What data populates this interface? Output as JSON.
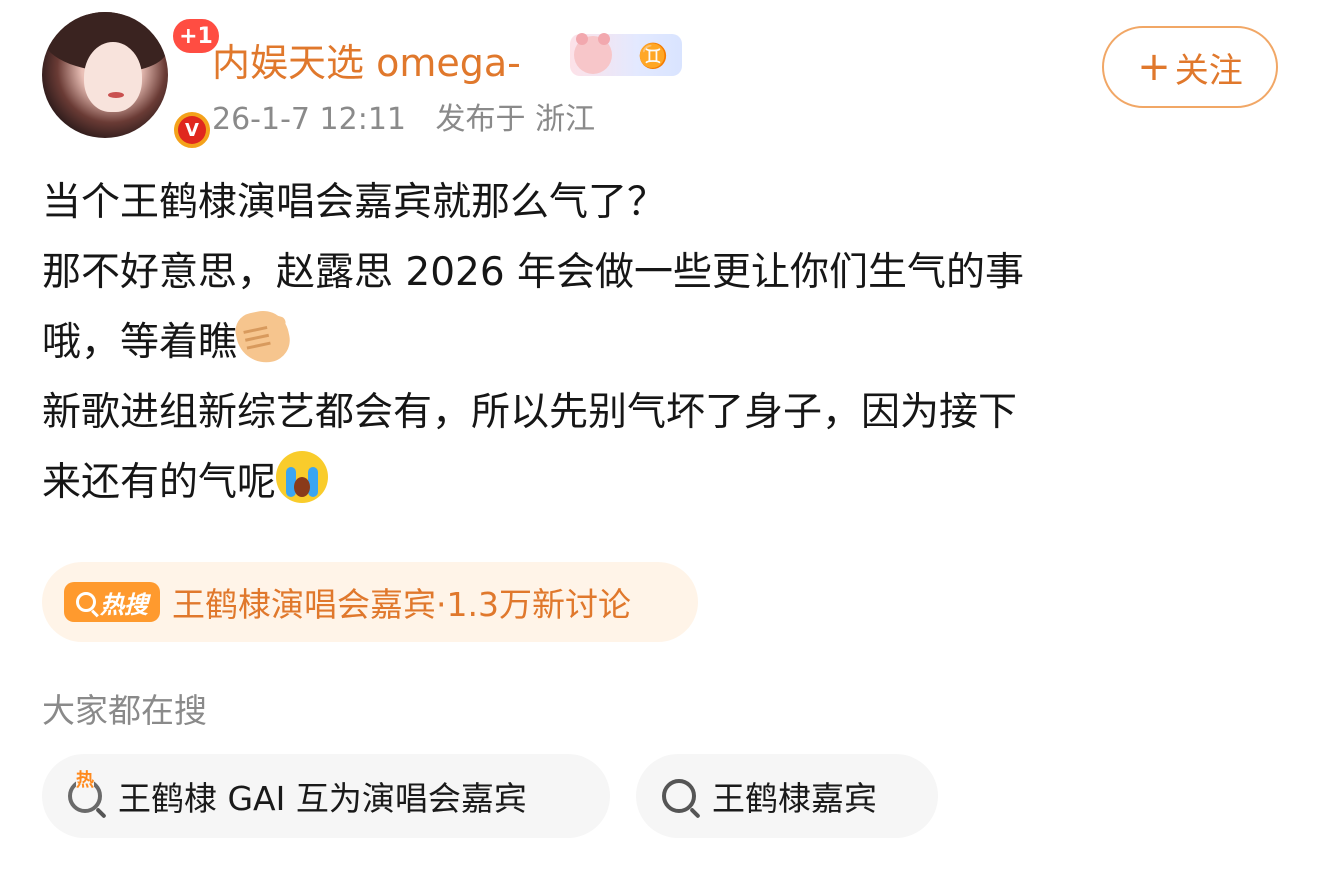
{
  "post": {
    "author": {
      "name": "内娱天选 omega-",
      "avatar_badge_count": "+1",
      "verified_badge": "V",
      "zodiac_badge_symbol": "♊"
    },
    "meta": {
      "time": "26-1-7 12:11",
      "location": "发布于 浙江"
    },
    "follow_label": "关注",
    "follow_plus": "+",
    "content_lines": [
      "当个王鹤棣演唱会嘉宾就那么气了？",
      "那不好意思，赵露思 2026 年会做一些更让你们生气的事",
      "哦，等着瞧",
      "新歌进组新综艺都会有，所以先别气坏了身子，因为接下",
      "来还有的气呢"
    ],
    "emojis": [
      "beckoning-hand-icon",
      "crying-face-icon"
    ],
    "hot_topic": {
      "tag": "热搜",
      "text": "王鹤棣演唱会嘉宾·1.3万新讨论",
      "color": "#e0782c"
    },
    "related": {
      "title": "大家都在搜",
      "items": [
        {
          "label": "王鹤棣 GAI 互为演唱会嘉宾",
          "hot_mark": "热"
        },
        {
          "label": "王鹤棣嘉宾"
        }
      ]
    }
  }
}
